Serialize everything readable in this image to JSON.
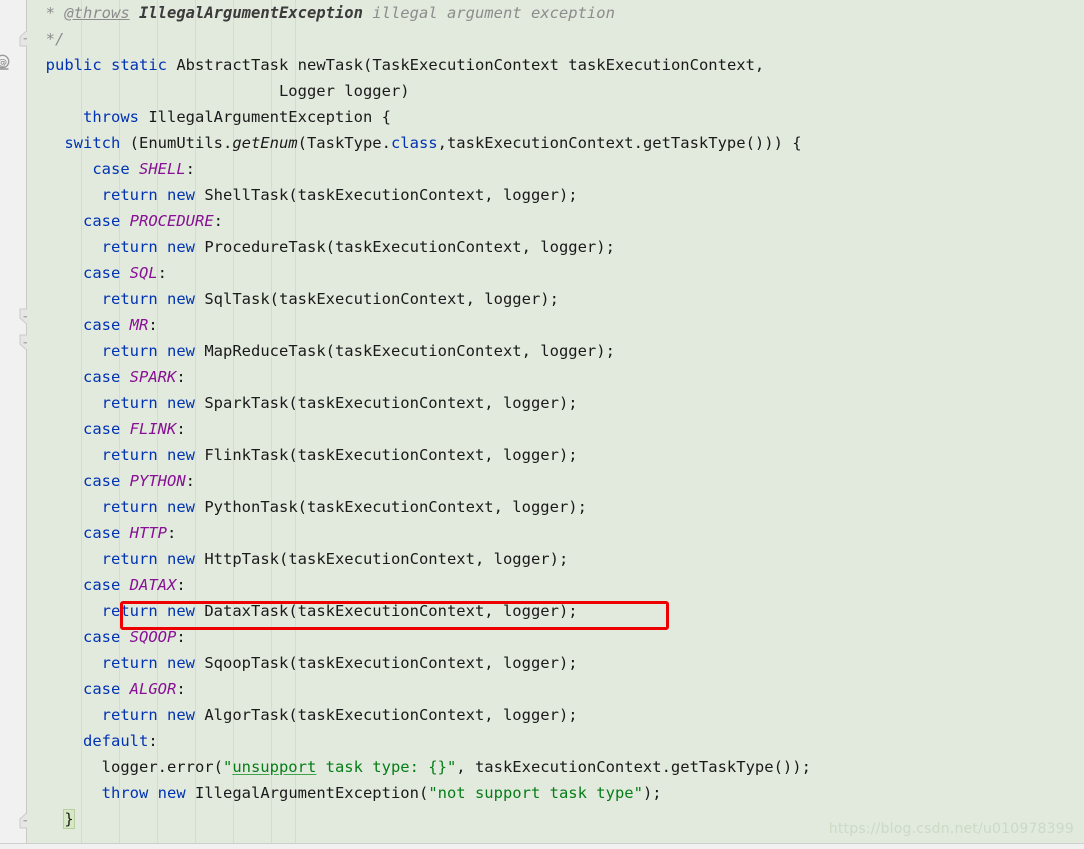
{
  "editor": {
    "background_color": "#e2eade",
    "gutter_color": "#f1f1f1",
    "annotation_rect_color": "#ee0000",
    "language": "Java"
  },
  "gutter": {
    "override_icon": "@",
    "fold_markers": [
      {
        "name": "fold-marker-up",
        "direction": "up"
      },
      {
        "name": "fold-marker-down",
        "direction": "down"
      },
      {
        "name": "fold-marker-down",
        "direction": "down"
      },
      {
        "name": "fold-marker-up",
        "direction": "up"
      }
    ]
  },
  "code": {
    "lines": [
      {
        "n": 1,
        "tokens": [
          {
            "t": "  * ",
            "c": "cmt"
          },
          {
            "t": "@throws",
            "c": "cmt-tag"
          },
          {
            "t": " ",
            "c": "cmt"
          },
          {
            "t": "IllegalArgumentException",
            "c": "cmt-bold"
          },
          {
            "t": " illegal argument exception",
            "c": "cmt"
          }
        ]
      },
      {
        "n": 2,
        "tokens": [
          {
            "t": "  */",
            "c": "cmt"
          }
        ]
      },
      {
        "n": 3,
        "tokens": [
          {
            "t": "  ",
            "c": "ident"
          },
          {
            "t": "public",
            "c": "kw"
          },
          {
            "t": " ",
            "c": "ident"
          },
          {
            "t": "static",
            "c": "kw"
          },
          {
            "t": " AbstractTask ",
            "c": "ident"
          },
          {
            "t": "newTask",
            "c": "ident"
          },
          {
            "t": "(TaskExecutionContext taskExecutionContext,",
            "c": "ident"
          }
        ]
      },
      {
        "n": 4,
        "tokens": [
          {
            "t": "                           Logger logger)",
            "c": "ident"
          }
        ]
      },
      {
        "n": 5,
        "tokens": [
          {
            "t": "      ",
            "c": "ident"
          },
          {
            "t": "throws",
            "c": "kw"
          },
          {
            "t": " IllegalArgumentException {",
            "c": "ident"
          }
        ]
      },
      {
        "n": 6,
        "tokens": [
          {
            "t": "    ",
            "c": "ident"
          },
          {
            "t": "switch",
            "c": "kw"
          },
          {
            "t": " (EnumUtils.",
            "c": "ident"
          },
          {
            "t": "getEnum",
            "c": "method-it"
          },
          {
            "t": "(TaskType.",
            "c": "ident"
          },
          {
            "t": "class",
            "c": "kw2"
          },
          {
            "t": ",taskExecutionContext.getTaskType())) {",
            "c": "ident"
          }
        ]
      },
      {
        "n": 7,
        "tokens": [
          {
            "t": "       ",
            "c": "ident"
          },
          {
            "t": "case",
            "c": "kw"
          },
          {
            "t": " ",
            "c": "ident"
          },
          {
            "t": "SHELL",
            "c": "enumc"
          },
          {
            "t": ":",
            "c": "ident"
          }
        ]
      },
      {
        "n": 8,
        "tokens": [
          {
            "t": "        ",
            "c": "ident"
          },
          {
            "t": "return",
            "c": "kw"
          },
          {
            "t": " ",
            "c": "ident"
          },
          {
            "t": "new",
            "c": "kw"
          },
          {
            "t": " ShellTask(taskExecutionContext, logger);",
            "c": "ident"
          }
        ]
      },
      {
        "n": 9,
        "tokens": [
          {
            "t": "      ",
            "c": "ident"
          },
          {
            "t": "case",
            "c": "kw"
          },
          {
            "t": " ",
            "c": "ident"
          },
          {
            "t": "PROCEDURE",
            "c": "enumc"
          },
          {
            "t": ":",
            "c": "ident"
          }
        ]
      },
      {
        "n": 10,
        "tokens": [
          {
            "t": "        ",
            "c": "ident"
          },
          {
            "t": "return",
            "c": "kw"
          },
          {
            "t": " ",
            "c": "ident"
          },
          {
            "t": "new",
            "c": "kw"
          },
          {
            "t": " ProcedureTask(taskExecutionContext, logger);",
            "c": "ident"
          }
        ]
      },
      {
        "n": 11,
        "tokens": [
          {
            "t": "      ",
            "c": "ident"
          },
          {
            "t": "case",
            "c": "kw"
          },
          {
            "t": " ",
            "c": "ident"
          },
          {
            "t": "SQL",
            "c": "enumc"
          },
          {
            "t": ":",
            "c": "ident"
          }
        ]
      },
      {
        "n": 12,
        "tokens": [
          {
            "t": "        ",
            "c": "ident"
          },
          {
            "t": "return",
            "c": "kw"
          },
          {
            "t": " ",
            "c": "ident"
          },
          {
            "t": "new",
            "c": "kw"
          },
          {
            "t": " SqlTask(taskExecutionContext, logger);",
            "c": "ident"
          }
        ]
      },
      {
        "n": 13,
        "tokens": [
          {
            "t": "      ",
            "c": "ident"
          },
          {
            "t": "case",
            "c": "kw"
          },
          {
            "t": " ",
            "c": "ident"
          },
          {
            "t": "MR",
            "c": "enumc"
          },
          {
            "t": ":",
            "c": "ident"
          }
        ]
      },
      {
        "n": 14,
        "tokens": [
          {
            "t": "        ",
            "c": "ident"
          },
          {
            "t": "return",
            "c": "kw"
          },
          {
            "t": " ",
            "c": "ident"
          },
          {
            "t": "new",
            "c": "kw"
          },
          {
            "t": " MapReduceTask(taskExecutionContext, logger);",
            "c": "ident"
          }
        ]
      },
      {
        "n": 15,
        "tokens": [
          {
            "t": "      ",
            "c": "ident"
          },
          {
            "t": "case",
            "c": "kw"
          },
          {
            "t": " ",
            "c": "ident"
          },
          {
            "t": "SPARK",
            "c": "enumc"
          },
          {
            "t": ":",
            "c": "ident"
          }
        ]
      },
      {
        "n": 16,
        "tokens": [
          {
            "t": "        ",
            "c": "ident"
          },
          {
            "t": "return",
            "c": "kw"
          },
          {
            "t": " ",
            "c": "ident"
          },
          {
            "t": "new",
            "c": "kw"
          },
          {
            "t": " SparkTask(taskExecutionContext, logger);",
            "c": "ident"
          }
        ]
      },
      {
        "n": 17,
        "tokens": [
          {
            "t": "      ",
            "c": "ident"
          },
          {
            "t": "case",
            "c": "kw"
          },
          {
            "t": " ",
            "c": "ident"
          },
          {
            "t": "FLINK",
            "c": "enumc"
          },
          {
            "t": ":",
            "c": "ident"
          }
        ]
      },
      {
        "n": 18,
        "tokens": [
          {
            "t": "        ",
            "c": "ident"
          },
          {
            "t": "return",
            "c": "kw"
          },
          {
            "t": " ",
            "c": "ident"
          },
          {
            "t": "new",
            "c": "kw"
          },
          {
            "t": " FlinkTask(taskExecutionContext, logger);",
            "c": "ident"
          }
        ]
      },
      {
        "n": 19,
        "tokens": [
          {
            "t": "      ",
            "c": "ident"
          },
          {
            "t": "case",
            "c": "kw"
          },
          {
            "t": " ",
            "c": "ident"
          },
          {
            "t": "PYTHON",
            "c": "enumc"
          },
          {
            "t": ":",
            "c": "ident"
          }
        ]
      },
      {
        "n": 20,
        "tokens": [
          {
            "t": "        ",
            "c": "ident"
          },
          {
            "t": "return",
            "c": "kw"
          },
          {
            "t": " ",
            "c": "ident"
          },
          {
            "t": "new",
            "c": "kw"
          },
          {
            "t": " PythonTask(taskExecutionContext, logger);",
            "c": "ident"
          }
        ]
      },
      {
        "n": 21,
        "tokens": [
          {
            "t": "      ",
            "c": "ident"
          },
          {
            "t": "case",
            "c": "kw"
          },
          {
            "t": " ",
            "c": "ident"
          },
          {
            "t": "HTTP",
            "c": "enumc"
          },
          {
            "t": ":",
            "c": "ident"
          }
        ]
      },
      {
        "n": 22,
        "tokens": [
          {
            "t": "        ",
            "c": "ident"
          },
          {
            "t": "return",
            "c": "kw"
          },
          {
            "t": " ",
            "c": "ident"
          },
          {
            "t": "new",
            "c": "kw"
          },
          {
            "t": " HttpTask(taskExecutionContext, logger);",
            "c": "ident"
          }
        ]
      },
      {
        "n": 23,
        "tokens": [
          {
            "t": "      ",
            "c": "ident"
          },
          {
            "t": "case",
            "c": "kw"
          },
          {
            "t": " ",
            "c": "ident"
          },
          {
            "t": "DATAX",
            "c": "enumc"
          },
          {
            "t": ":",
            "c": "ident"
          }
        ]
      },
      {
        "n": 24,
        "highlighted": true,
        "tokens": [
          {
            "t": "        ",
            "c": "ident"
          },
          {
            "t": "return",
            "c": "kw"
          },
          {
            "t": " ",
            "c": "ident"
          },
          {
            "t": "new",
            "c": "kw"
          },
          {
            "t": " DataxTask(taskExecutionContext, logger);",
            "c": "ident"
          }
        ]
      },
      {
        "n": 25,
        "tokens": [
          {
            "t": "      ",
            "c": "ident"
          },
          {
            "t": "case",
            "c": "kw"
          },
          {
            "t": " ",
            "c": "ident"
          },
          {
            "t": "SQOOP",
            "c": "enumc"
          },
          {
            "t": ":",
            "c": "ident"
          }
        ]
      },
      {
        "n": 26,
        "tokens": [
          {
            "t": "        ",
            "c": "ident"
          },
          {
            "t": "return",
            "c": "kw"
          },
          {
            "t": " ",
            "c": "ident"
          },
          {
            "t": "new",
            "c": "kw"
          },
          {
            "t": " SqoopTask(taskExecutionContext, logger);",
            "c": "ident"
          }
        ]
      },
      {
        "n": 27,
        "tokens": [
          {
            "t": "      ",
            "c": "ident"
          },
          {
            "t": "case",
            "c": "kw"
          },
          {
            "t": " ",
            "c": "ident"
          },
          {
            "t": "ALGOR",
            "c": "enumc"
          },
          {
            "t": ":",
            "c": "ident"
          }
        ]
      },
      {
        "n": 28,
        "tokens": [
          {
            "t": "        ",
            "c": "ident"
          },
          {
            "t": "return",
            "c": "kw"
          },
          {
            "t": " ",
            "c": "ident"
          },
          {
            "t": "new",
            "c": "kw"
          },
          {
            "t": " AlgorTask(taskExecutionContext, logger);",
            "c": "ident"
          }
        ]
      },
      {
        "n": 29,
        "tokens": [
          {
            "t": "      ",
            "c": "ident"
          },
          {
            "t": "default",
            "c": "kw"
          },
          {
            "t": ":",
            "c": "ident"
          }
        ]
      },
      {
        "n": 30,
        "tokens": [
          {
            "t": "        logger.error(",
            "c": "ident"
          },
          {
            "t": "\"",
            "c": "str"
          },
          {
            "t": "unsupport",
            "c": "str typo"
          },
          {
            "t": " task type: {}\"",
            "c": "str"
          },
          {
            "t": ", taskExecutionContext.getTaskType());",
            "c": "ident"
          }
        ]
      },
      {
        "n": 31,
        "tokens": [
          {
            "t": "        ",
            "c": "ident"
          },
          {
            "t": "throw",
            "c": "kw"
          },
          {
            "t": " ",
            "c": "ident"
          },
          {
            "t": "new",
            "c": "kw"
          },
          {
            "t": " IllegalArgumentException(",
            "c": "ident"
          },
          {
            "t": "\"not support task type\"",
            "c": "str"
          },
          {
            "t": ");",
            "c": "ident"
          }
        ]
      },
      {
        "n": 32,
        "brace_match": true,
        "tokens": [
          {
            "t": "    ",
            "c": "ident"
          },
          {
            "t": "}",
            "c": "ident"
          }
        ]
      }
    ]
  },
  "watermark": {
    "text": "https://blog.csdn.net/u010978399"
  }
}
